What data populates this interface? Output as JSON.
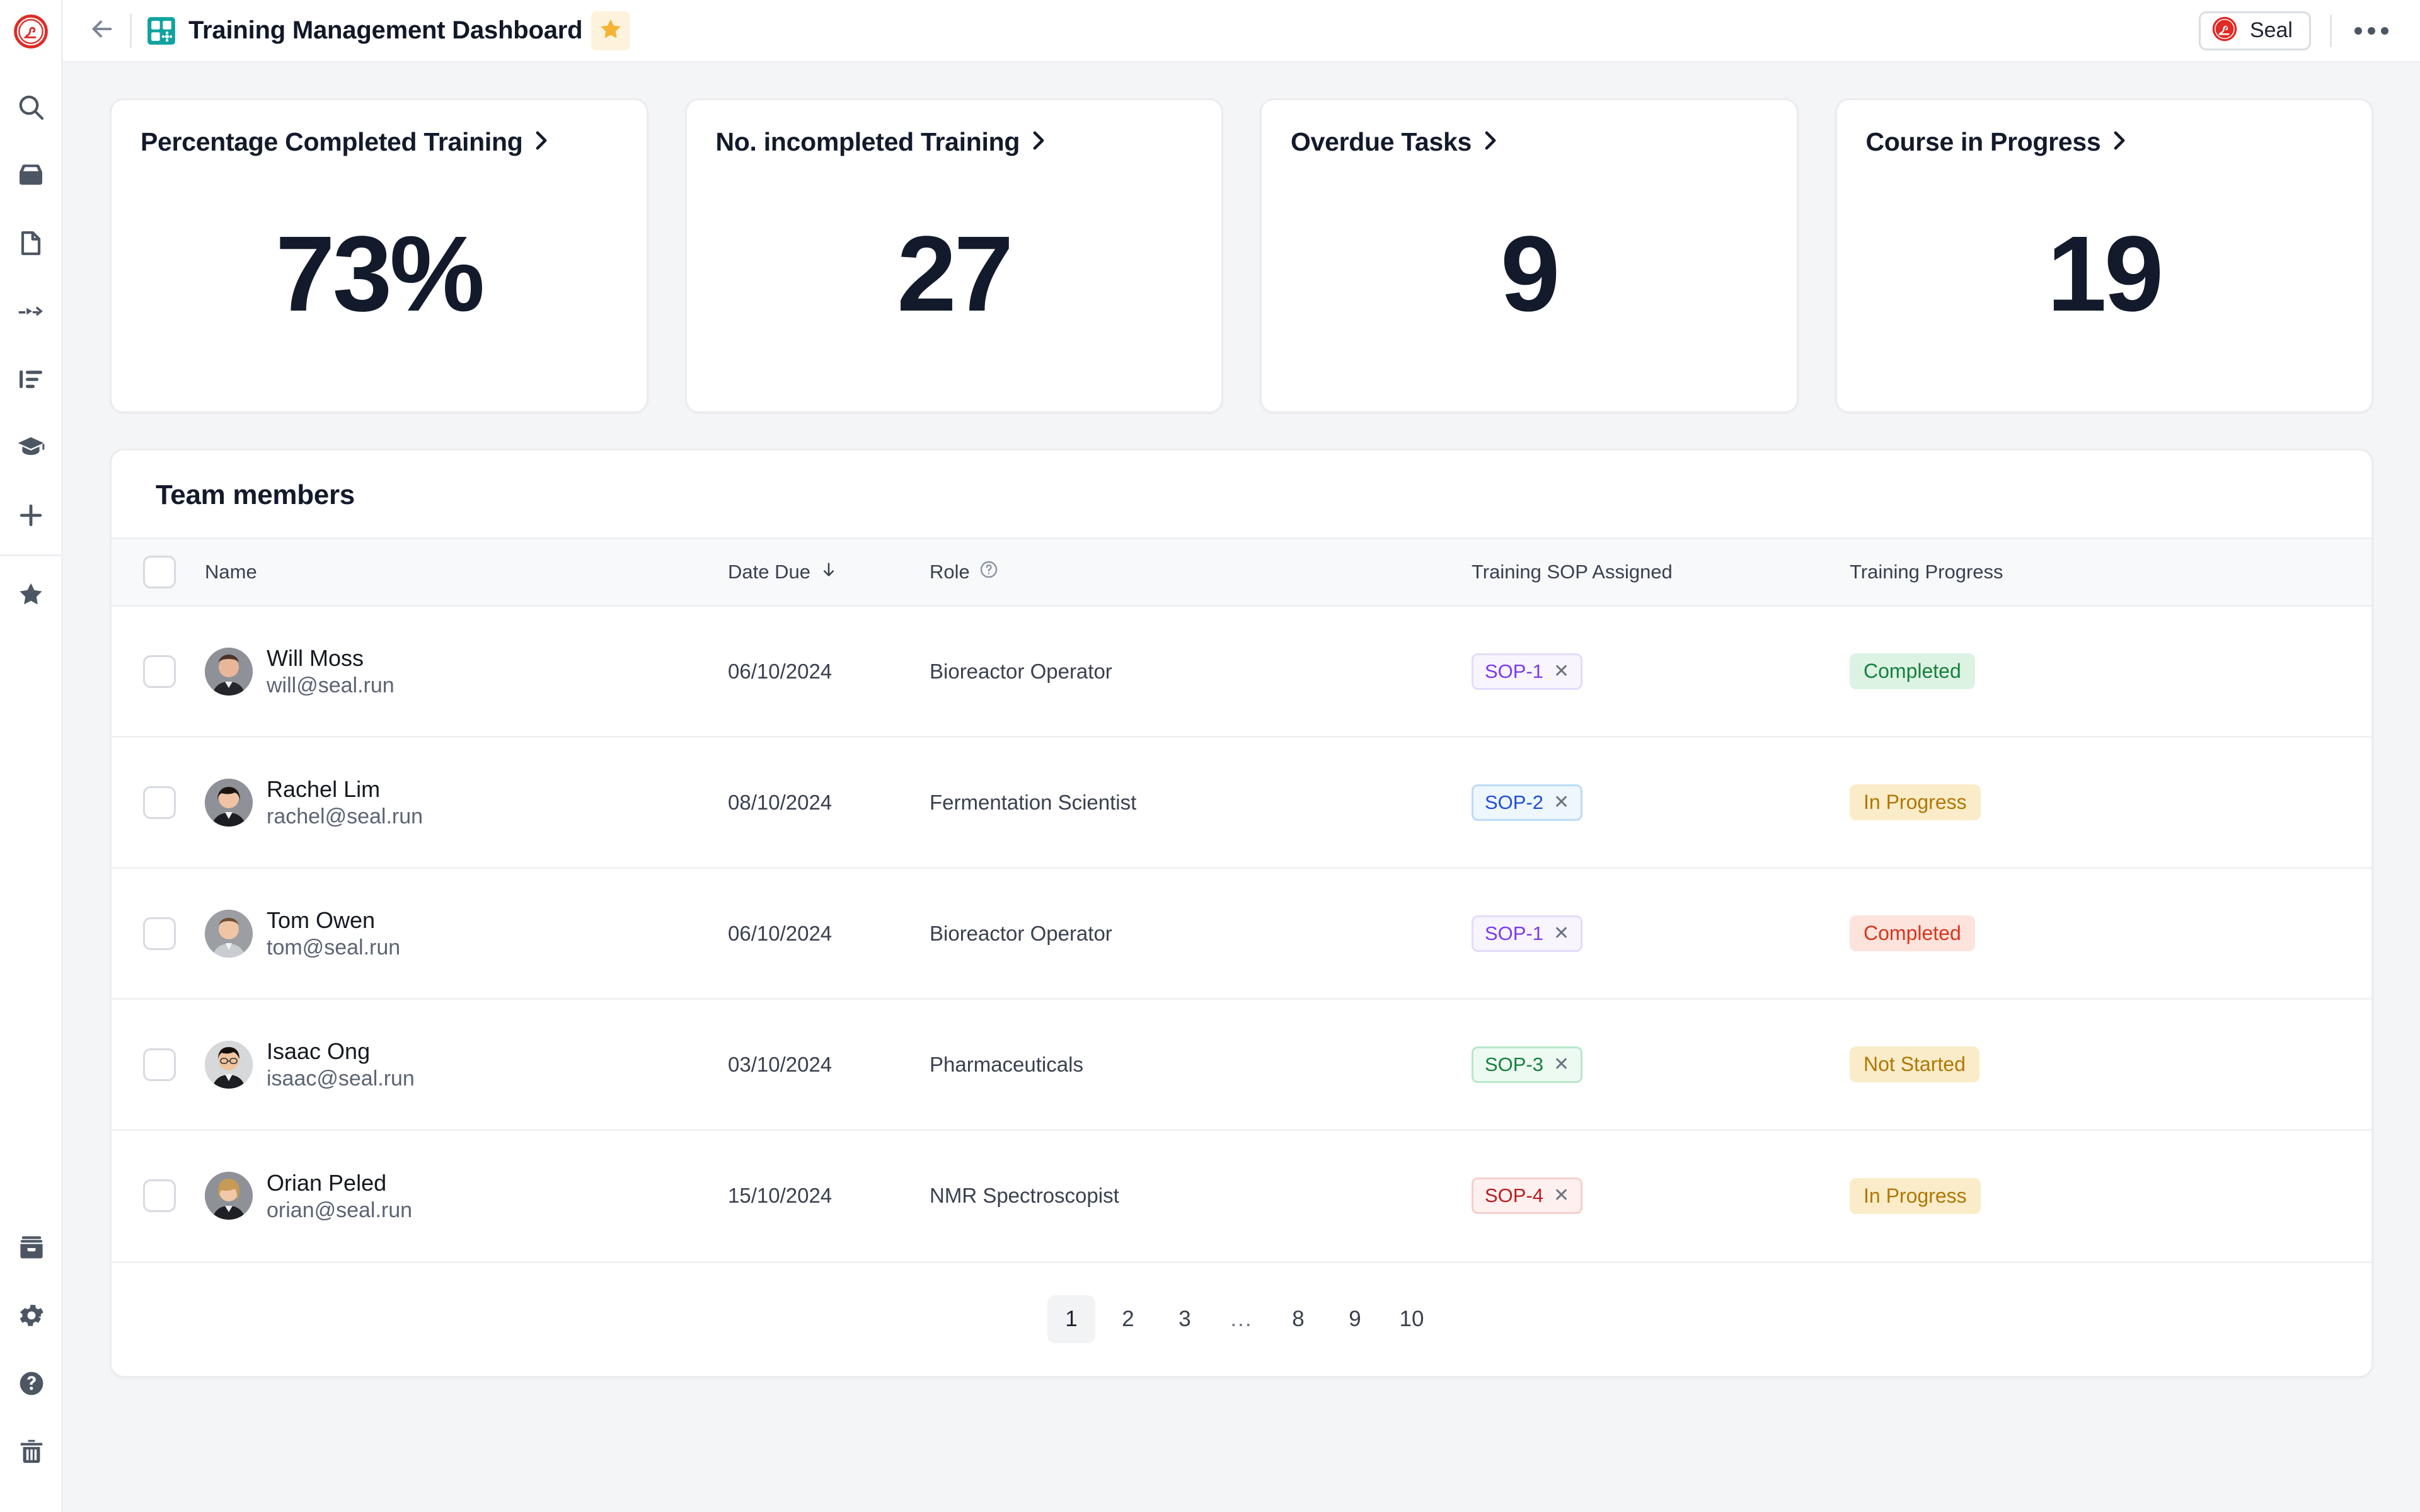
{
  "header": {
    "back_icon": "arrow-left-icon",
    "app_icon": "dashboard-grid-icon",
    "title": "Training Management Dashboard",
    "star_icon": "star-filled-icon",
    "user_name": "Seal",
    "user_logo_icon": "seal-wax-logo-icon",
    "more_icon": "more-horizontal-icon",
    "accent_teal": "#0fa3a0",
    "star_color": "#f5b335",
    "brand_red": "#e02a26"
  },
  "sidebar": {
    "logo_icon": "seal-wax-logo-icon",
    "top_items": [
      {
        "icon": "search-icon",
        "label": "Search"
      },
      {
        "icon": "inbox-icon",
        "label": "Inbox"
      },
      {
        "icon": "document-icon",
        "label": "Documents"
      },
      {
        "icon": "workflow-arrow-icon",
        "label": "Workflows"
      },
      {
        "icon": "list-bars-icon",
        "label": "Tasks"
      },
      {
        "icon": "graduation-cap-icon",
        "label": "Training"
      },
      {
        "icon": "plus-icon",
        "label": "Create"
      }
    ],
    "favorites": [
      {
        "icon": "star-icon",
        "label": "Favourites"
      }
    ],
    "bottom_items": [
      {
        "icon": "archive-icon",
        "label": "Archive"
      },
      {
        "icon": "gear-icon",
        "label": "Settings"
      },
      {
        "icon": "question-circle-icon",
        "label": "Help"
      },
      {
        "icon": "trash-icon",
        "label": "Trash"
      }
    ]
  },
  "kpis": [
    {
      "title": "Percentage Completed Training",
      "value": "73%",
      "chevron": "chevron-right-icon"
    },
    {
      "title": "No. incompleted Training",
      "value": "27",
      "chevron": "chevron-right-icon"
    },
    {
      "title": "Overdue Tasks",
      "value": "9",
      "chevron": "chevron-right-icon"
    },
    {
      "title": "Course in Progress",
      "value": "19",
      "chevron": "chevron-right-icon"
    }
  ],
  "table": {
    "title": "Team members",
    "columns": {
      "name": "Name",
      "date_due": "Date Due",
      "date_due_sort_icon": "arrow-down-icon",
      "role": "Role",
      "role_help_icon": "question-circle-outline-icon",
      "sop": "Training SOP Assigned",
      "progress": "Training Progress"
    },
    "rows": [
      {
        "name": "Will Moss",
        "email": "will@seal.run",
        "avatar": "avatar-will",
        "date_due": "06/10/2024",
        "role": "Bioreactor Operator",
        "sop": {
          "label": "SOP-1",
          "remove_icon": "close-icon",
          "text": "#7c3aed",
          "bg": "#f8f5ff",
          "border": "#e4dbfb"
        },
        "progress": {
          "label": "Completed",
          "text": "#17803d",
          "bg": "#dcf3e4"
        }
      },
      {
        "name": "Rachel Lim",
        "email": "rachel@seal.run",
        "avatar": "avatar-rachel",
        "date_due": "08/10/2024",
        "role": "Fermentation Scientist",
        "sop": {
          "label": "SOP-2",
          "remove_icon": "close-icon",
          "text": "#1d4ed8",
          "bg": "#eef6fe",
          "border": "#bcdcf7"
        },
        "progress": {
          "label": "In Progress",
          "text": "#b07706",
          "bg": "#faecc8"
        }
      },
      {
        "name": "Tom Owen",
        "email": "tom@seal.run",
        "avatar": "avatar-tom",
        "date_due": "06/10/2024",
        "role": "Bioreactor Operator",
        "sop": {
          "label": "SOP-1",
          "remove_icon": "close-icon",
          "text": "#7c3aed",
          "bg": "#f8f5ff",
          "border": "#e4dbfb"
        },
        "progress": {
          "label": "Completed",
          "text": "#d8351e",
          "bg": "#fce3dc"
        }
      },
      {
        "name": "Isaac Ong",
        "email": "isaac@seal.run",
        "avatar": "avatar-isaac",
        "date_due": "03/10/2024",
        "role": "Pharmaceuticals",
        "sop": {
          "label": "SOP-3",
          "remove_icon": "close-icon",
          "text": "#15803d",
          "bg": "#edfaf1",
          "border": "#b8e7c9"
        },
        "progress": {
          "label": "Not Started",
          "text": "#b07706",
          "bg": "#faecc8"
        }
      },
      {
        "name": "Orian Peled",
        "email": "orian@seal.run",
        "avatar": "avatar-orian",
        "date_due": "15/10/2024",
        "role": "NMR Spectroscopist",
        "sop": {
          "label": "SOP-4",
          "remove_icon": "close-icon",
          "text": "#b91c1c",
          "bg": "#fdf0ef",
          "border": "#f6cfcb"
        },
        "progress": {
          "label": "In Progress",
          "text": "#b07706",
          "bg": "#faecc8"
        }
      }
    ],
    "pagination": {
      "pages": [
        "1",
        "2",
        "3",
        "...",
        "8",
        "9",
        "10"
      ],
      "active": "1"
    }
  }
}
